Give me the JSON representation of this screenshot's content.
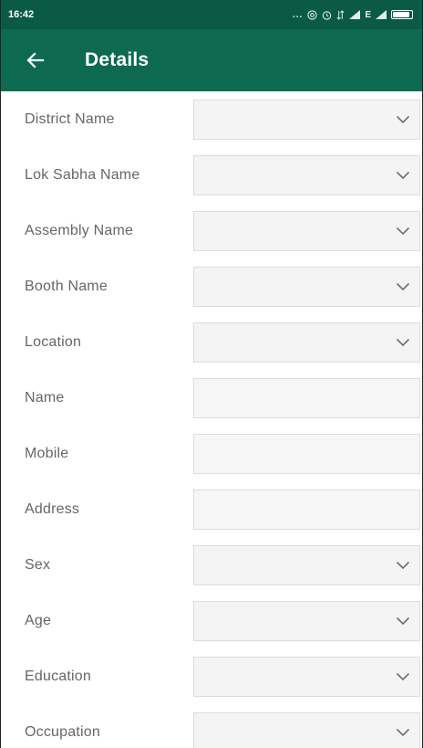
{
  "status_bar": {
    "time": "16:42",
    "dots": "...",
    "net_label": "E"
  },
  "app_bar": {
    "title": "Details"
  },
  "form": {
    "fields": [
      {
        "label": "District Name",
        "type": "select",
        "value": ""
      },
      {
        "label": "Lok Sabha Name",
        "type": "select",
        "value": ""
      },
      {
        "label": "Assembly Name",
        "type": "select",
        "value": ""
      },
      {
        "label": "Booth Name",
        "type": "select",
        "value": ""
      },
      {
        "label": "Location",
        "type": "select",
        "value": ""
      },
      {
        "label": "Name",
        "type": "input",
        "value": ""
      },
      {
        "label": "Mobile",
        "type": "input",
        "value": ""
      },
      {
        "label": "Address",
        "type": "input",
        "value": ""
      },
      {
        "label": "Sex",
        "type": "select",
        "value": ""
      },
      {
        "label": "Age",
        "type": "select",
        "value": ""
      },
      {
        "label": "Education",
        "type": "select",
        "value": ""
      },
      {
        "label": "Occupation",
        "type": "select",
        "value": ""
      }
    ]
  },
  "colors": {
    "status_bar": "#0b5a45",
    "app_bar": "#0d6a51",
    "label_text": "#666666",
    "field_bg": "#f4f4f4"
  }
}
